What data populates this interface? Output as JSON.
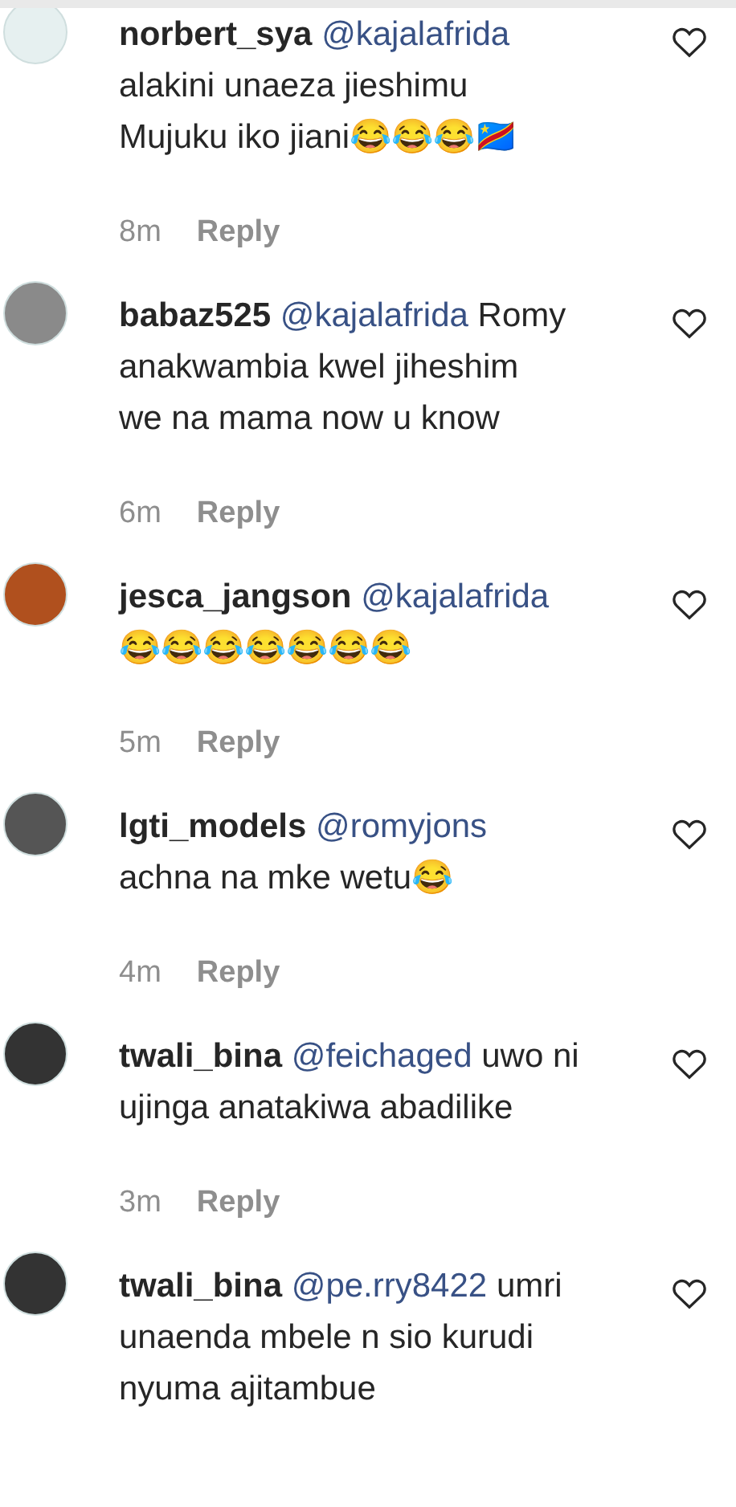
{
  "comments": [
    {
      "username": "norbert_sya",
      "mention": "@kajalafrida",
      "text": "\nalakini unaeza jieshimu\nMujuku iko jiani😂😂😂🇨🇩",
      "time": "8m",
      "reply": "Reply",
      "color": "#e6f0f0",
      "liked": false
    },
    {
      "username": "babaz525",
      "mention": "@kajalafrida",
      "text": "Romy\nanakwambia kwel jiheshim\nwe na mama now u know",
      "time": "6m",
      "reply": "Reply",
      "color": "#8a8a8a",
      "liked": false
    },
    {
      "username": "jesca_jangson",
      "mention": "@kajalafrida",
      "text": "\n😂😂😂😂😂😂😂",
      "time": "5m",
      "reply": "Reply",
      "color": "#b0501e",
      "liked": false
    },
    {
      "username": "lgti_models",
      "mention": "@romyjons",
      "text": "\nachna na mke wetu😂",
      "time": "4m",
      "reply": "Reply",
      "color": "#555555",
      "liked": false
    },
    {
      "username": "twali_bina",
      "mention": "@feichaged",
      "text": "uwo ni\nujinga anatakiwa abadilike",
      "time": "3m",
      "reply": "Reply",
      "color": "#333333",
      "liked": false
    },
    {
      "username": "twali_bina",
      "mention": "@pe.rry8422",
      "text": "umri\nunaenda mbele n sio kurudi\nnyuma ajitambue",
      "color": "#333333",
      "liked": false
    }
  ]
}
